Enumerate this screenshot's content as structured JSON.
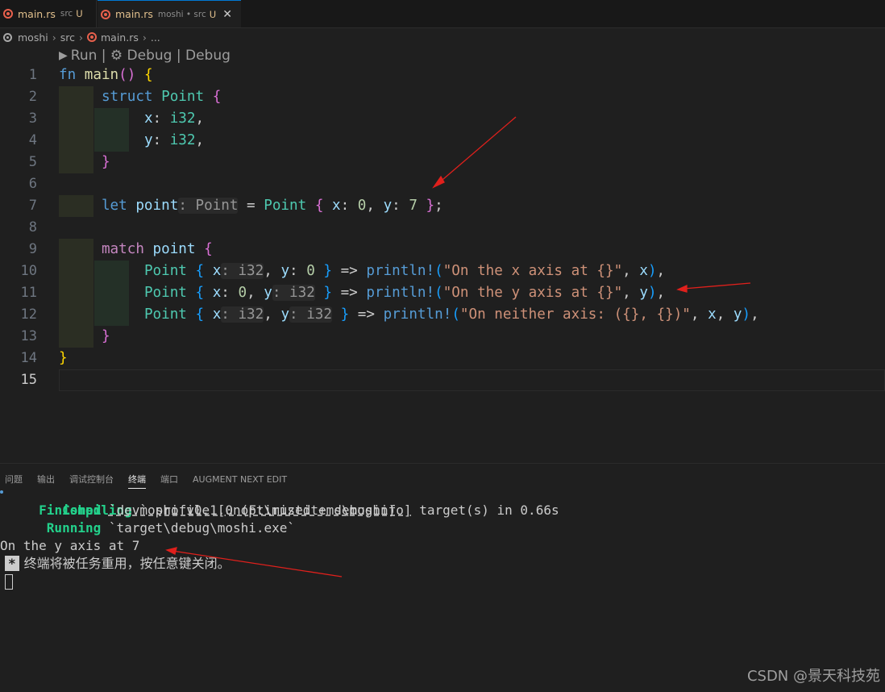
{
  "tabs": [
    {
      "name": "main.rs",
      "path": "src",
      "badge": "U"
    },
    {
      "name": "main.rs",
      "path": "moshi • src",
      "badge": "U",
      "close": "✕"
    }
  ],
  "breadcrumb": [
    "moshi",
    "src",
    "main.rs",
    "..."
  ],
  "codelens": "Run | ⚙ Debug | Debug",
  "line_numbers": [
    "1",
    "2",
    "3",
    "4",
    "5",
    "6",
    "7",
    "8",
    "9",
    "10",
    "11",
    "12",
    "13",
    "14",
    "15"
  ],
  "code": {
    "l1": [
      "fn",
      "main",
      "()",
      "{"
    ],
    "l2": [
      "struct",
      "Point",
      "{"
    ],
    "l3": [
      "x",
      ": ",
      "i32",
      ","
    ],
    "l4": [
      "y",
      ": ",
      "i32",
      ","
    ],
    "l5": [
      "}"
    ],
    "l7": [
      "let",
      "point",
      ": Point",
      " = ",
      "Point",
      "{",
      "x",
      ": ",
      "0",
      ", ",
      "y",
      ": ",
      "7",
      "}",
      ";"
    ],
    "l9": [
      "match",
      "point",
      "{"
    ],
    "l10": [
      "Point",
      "{",
      "x",
      ": i32",
      ", ",
      "y",
      ": ",
      "0",
      "}",
      " => ",
      "println!",
      "(",
      "\"On the x axis at {}\"",
      ", ",
      "x",
      ")",
      ","
    ],
    "l11": [
      "Point",
      "{",
      "x",
      ": ",
      "0",
      ", ",
      "y",
      ": i32",
      "}",
      " => ",
      "println!",
      "(",
      "\"On the y axis at {}\"",
      ", ",
      "y",
      ")",
      ","
    ],
    "l12": [
      "Point",
      "{",
      "x",
      ": i32",
      ", ",
      "y",
      ": i32",
      "}",
      " => ",
      "println!",
      "(",
      "\"On neither axis: ({}, {})\"",
      ", ",
      "x",
      ", ",
      "y",
      ")",
      ","
    ],
    "l13": [
      "}"
    ],
    "l14": [
      "}"
    ]
  },
  "panel": {
    "tabs": [
      "问题",
      "输出",
      "调试控制台",
      "终端",
      "端口",
      "AUGMENT NEXT EDIT"
    ],
    "active_tab": "终端"
  },
  "terminal": {
    "compiling_label": "Compiling",
    "compiling_text": " moshi v0.1.0 (F:\\rustitems\\moshi)",
    "finished_label": "Finished",
    "finished_profile": "`dev` profile [unoptimized + debuginfo]",
    "finished_text": " target(s) in 0.66s",
    "running_label": "Running",
    "running_text": " `target\\debug\\moshi.exe`",
    "output": "On the y axis at 7",
    "star": "*",
    "reuse_msg": "终端将被任务重用，按任意键关闭。"
  },
  "watermark": "CSDN @景天科技苑",
  "colors": {
    "annotation_arrow": "#e0201c",
    "accent": "#0078d4"
  }
}
